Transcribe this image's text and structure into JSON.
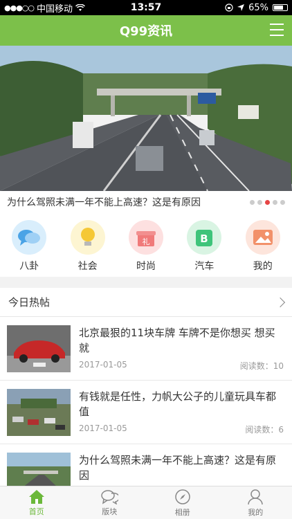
{
  "status": {
    "carrier": "中国移动",
    "time": "13:57",
    "battery": "65%"
  },
  "app": {
    "title": "Q99资讯"
  },
  "banner": {
    "caption": "为什么驾照未满一年不能上高速？这是有原因",
    "pages": 5,
    "active_page": 3
  },
  "categories": [
    {
      "label": "八卦",
      "icon": "chat-bubbles-icon",
      "color": "#d9eefc"
    },
    {
      "label": "社会",
      "icon": "lightbulb-icon",
      "color": "#fdf5d2"
    },
    {
      "label": "时尚",
      "icon": "gift-icon",
      "color": "#fde0e0"
    },
    {
      "label": "汽车",
      "icon": "car-b-icon",
      "color": "#d9f4e3"
    },
    {
      "label": "我的",
      "icon": "photo-icon",
      "color": "#fde5dc"
    }
  ],
  "hot": {
    "title": "今日热帖"
  },
  "posts": [
    {
      "title": "北京最狠的11块车牌 车牌不是你想买 想买就",
      "date": "2017-01-05",
      "reads_label": "阅读数：",
      "reads": "10"
    },
    {
      "title": "有钱就是任性，力帆大公子的儿童玩具车都值",
      "date": "2017-01-05",
      "reads_label": "阅读数：",
      "reads": "6"
    },
    {
      "title": "为什么驾照未满一年不能上高速？这是有原因",
      "date": "",
      "reads_label": "",
      "reads": ""
    }
  ],
  "tabs": [
    {
      "label": "首页",
      "icon": "home-icon",
      "active": true
    },
    {
      "label": "版块",
      "icon": "forum-icon",
      "active": false
    },
    {
      "label": "相册",
      "icon": "compass-icon",
      "active": false
    },
    {
      "label": "我的",
      "icon": "user-icon",
      "active": false
    }
  ]
}
